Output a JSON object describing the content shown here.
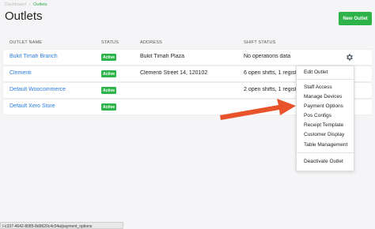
{
  "breadcrumb": {
    "home": "Dashboard",
    "separator": ">",
    "current": "Outlets"
  },
  "page": {
    "title": "Outlets",
    "new_outlet_label": "New Outlet"
  },
  "table": {
    "headers": {
      "name": "OUTLET NAME",
      "status": "STATUS",
      "address": "ADDRESS",
      "shift": "SHIFT STATUS"
    },
    "rows": [
      {
        "name": "Bukit Timah Branch",
        "status": "Active",
        "address": "Bukit Timah Plaza",
        "shift": "No operations data"
      },
      {
        "name": "Clementi",
        "status": "Active",
        "address": "Clementi Street 14, 120102",
        "shift": "6 open shifts, 1 registe"
      },
      {
        "name": "Default Woocommerce",
        "status": "Active",
        "address": "",
        "shift": "2 open shifts, 1 registe"
      },
      {
        "name": "Default Xero Store",
        "status": "Active",
        "address": "",
        "shift": ""
      }
    ]
  },
  "menu": {
    "edit": "Edit Outlet",
    "staff": "Staff Access",
    "devices": "Manage Devices",
    "payment": "Payment Options",
    "pos": "Pos Configs",
    "receipt": "Receipt Template",
    "customer": "Customer Display",
    "table": "Table Management",
    "deactivate": "Deactivate Outlet"
  },
  "statusbar": {
    "url": "/-c337-4642-8085-8d9620c4c04a/payment_options"
  },
  "colors": {
    "accent": "#2db34a",
    "link": "#2a7de1",
    "arrow": "#e8532b"
  }
}
